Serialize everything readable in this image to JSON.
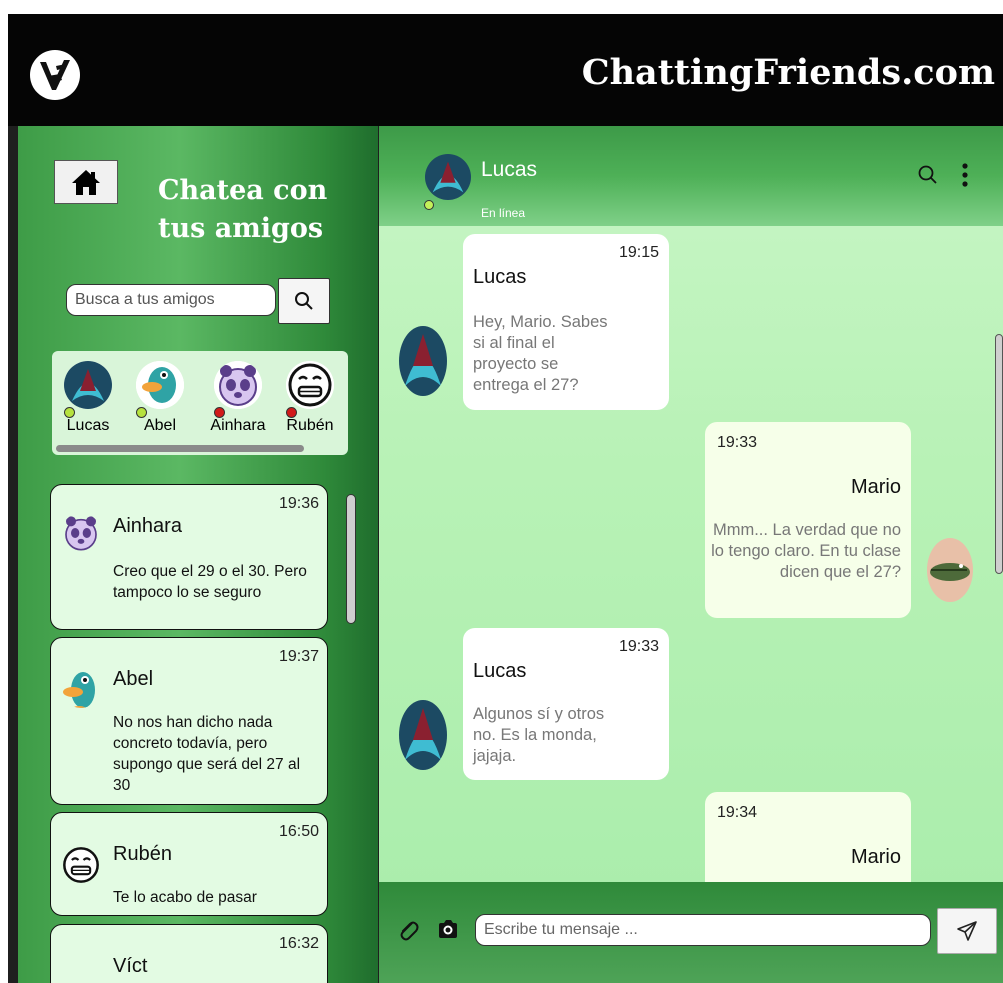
{
  "header": {
    "site_title": "ChattingFriends.com",
    "logo_icon": "hand-logo-icon"
  },
  "sidebar": {
    "title": "Chatea con tus amigos",
    "home_icon": "home-icon",
    "search": {
      "placeholder": "Busca a tus amigos",
      "value": ""
    },
    "search_icon": "search-icon",
    "friends": [
      {
        "name": "Lucas",
        "status_color": "#b6e23e",
        "avatar": "dragon-avatar"
      },
      {
        "name": "Abel",
        "status_color": "#b6e23e",
        "avatar": "platypus-avatar"
      },
      {
        "name": "Ainhara",
        "status_color": "#d11a1a",
        "avatar": "panda-avatar"
      },
      {
        "name": "Rubén",
        "status_color": "#d11a1a",
        "avatar": "grimace-avatar"
      }
    ],
    "chats": [
      {
        "name": "Ainhara",
        "time": "19:36",
        "message": "Creo que el 29 o el 30. Pero tampoco lo se seguro",
        "avatar": "panda-avatar"
      },
      {
        "name": "Abel",
        "time": "19:37",
        "message": "No nos han dicho nada concreto todavía, pero supongo que será del 27 al 30",
        "avatar": "platypus-avatar"
      },
      {
        "name": "Rubén",
        "time": "16:50",
        "message": "Te lo acabo de pasar",
        "avatar": "grimace-avatar"
      },
      {
        "name": "Víct",
        "time": "16:32",
        "message": "",
        "avatar": ""
      }
    ]
  },
  "conversation": {
    "contact_name": "Lucas",
    "contact_status": "En línea",
    "status_color": "#c4f05a",
    "messages": [
      {
        "direction": "in",
        "sender": "Lucas",
        "time": "19:15",
        "text": "Hey, Mario. Sabes si al final el proyecto se entrega el 27?"
      },
      {
        "direction": "out",
        "sender": "Mario",
        "time": "19:33",
        "text": "Mmm... La verdad que no lo tengo claro. En tu clase dicen que el 27?"
      },
      {
        "direction": "in",
        "sender": "Lucas",
        "time": "19:33",
        "text": "Algunos sí y otros no. Es la monda, jajaja."
      },
      {
        "direction": "out",
        "sender": "Mario",
        "time": "19:34",
        "text": ""
      }
    ]
  },
  "composer": {
    "placeholder": "Escribe tu mensaje ...",
    "value": "",
    "attach_icon": "paperclip-icon",
    "camera_icon": "camera-icon",
    "send_icon": "send-icon"
  }
}
